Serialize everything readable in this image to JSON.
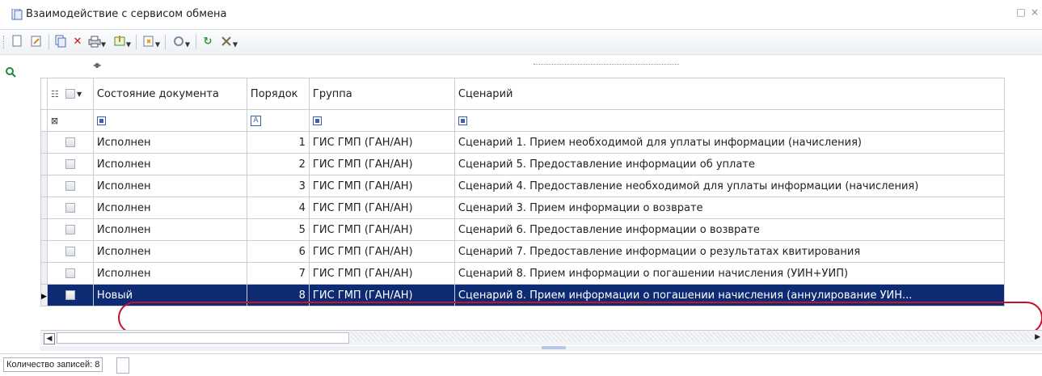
{
  "window": {
    "title": "Взаимодействие с сервисом обмена",
    "controls": [
      "□",
      "×"
    ]
  },
  "toolbar": {
    "buttons": [
      {
        "name": "new-document-button",
        "glyph": "▢"
      },
      {
        "name": "edit-button",
        "glyph": "✎"
      },
      {
        "name": "copy-button",
        "glyph": "⎘"
      },
      {
        "name": "delete-button",
        "glyph": "×"
      },
      {
        "name": "print-button",
        "glyph": "⎙"
      },
      {
        "name": "export-button",
        "glyph": "⇪"
      },
      {
        "name": "import-button",
        "glyph": "⇩"
      },
      {
        "name": "actions-button",
        "glyph": "⚙"
      },
      {
        "name": "refresh-button",
        "glyph": "↻"
      },
      {
        "name": "settings-button",
        "glyph": "✂"
      }
    ]
  },
  "grid": {
    "columns": [
      "Состояние документа",
      "Порядок",
      "Группа",
      "Сценарий"
    ],
    "rows": [
      {
        "state": "Исполнен",
        "order": "1",
        "group": "ГИС ГМП (ГАН/АН)",
        "scenario": "Сценарий 1. Прием необходимой для уплаты информации (начисления)"
      },
      {
        "state": "Исполнен",
        "order": "2",
        "group": "ГИС ГМП (ГАН/АН)",
        "scenario": "Сценарий 5. Предоставление информации об уплате"
      },
      {
        "state": "Исполнен",
        "order": "3",
        "group": "ГИС ГМП (ГАН/АН)",
        "scenario": "Сценарий 4. Предоставление необходимой для уплаты информации (начисления)"
      },
      {
        "state": "Исполнен",
        "order": "4",
        "group": "ГИС ГМП (ГАН/АН)",
        "scenario": "Сценарий 3. Прием информации о возврате"
      },
      {
        "state": "Исполнен",
        "order": "5",
        "group": "ГИС ГМП (ГАН/АН)",
        "scenario": "Сценарий 6. Предоставление информации о возврате"
      },
      {
        "state": "Исполнен",
        "order": "6",
        "group": "ГИС ГМП (ГАН/АН)",
        "scenario": "Сценарий 7. Предоставление информации о результатах квитирования"
      },
      {
        "state": "Исполнен",
        "order": "7",
        "group": "ГИС ГМП (ГАН/АН)",
        "scenario": "Сценарий 8. Прием информации о погашении начисления (УИН+УИП)"
      },
      {
        "state": "Новый",
        "order": "8",
        "group": "ГИС ГМП (ГАН/АН)",
        "scenario": "Сценарий 8. Прием информации о погашении начисления (аннулирование УИН..."
      }
    ],
    "selected_row": 8
  },
  "status": {
    "record_count": "Количество записей: 8"
  },
  "colors": {
    "selection": "#0d2b72",
    "highlight": "#c8102e"
  }
}
